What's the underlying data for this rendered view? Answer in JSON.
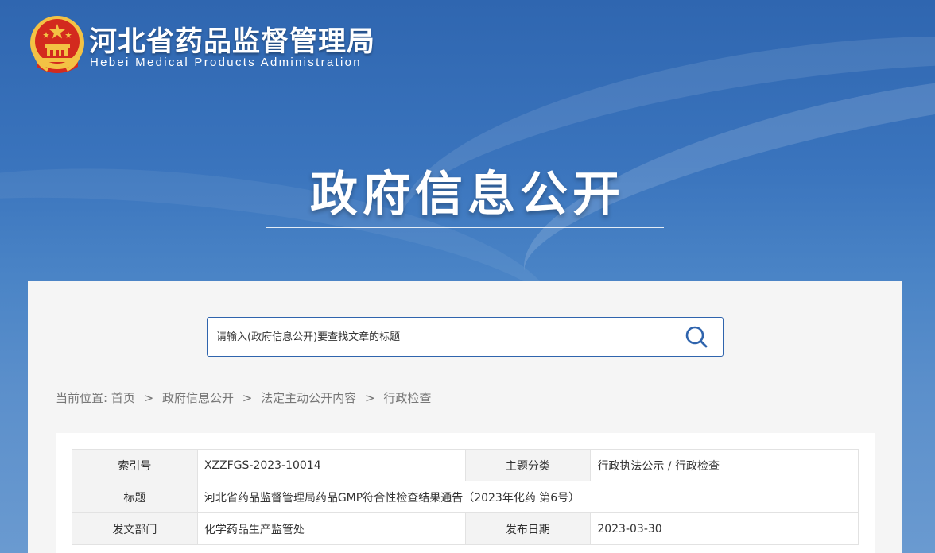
{
  "header": {
    "org_name_cn": "河北省药品监督管理局",
    "org_name_en": "Hebei Medical Products Administration",
    "page_heading": "政府信息公开",
    "colors": {
      "hero_blue": "#3a74bd",
      "emblem_red": "#d32a1e",
      "emblem_gold": "#f3c244"
    }
  },
  "search": {
    "placeholder": "请输入(政府信息公开)要查找文章的标题",
    "icon": "search-icon"
  },
  "breadcrumb": {
    "prefix": "当前位置:",
    "items": [
      "首页",
      "政府信息公开",
      "法定主动公开内容",
      "行政检查"
    ],
    "separator": ">"
  },
  "info_table": {
    "index_label": "索引号",
    "index_value": "XZZFGS-2023-10014",
    "topic_label": "主题分类",
    "topic_value": "行政执法公示 / 行政检查",
    "title_label": "标题",
    "title_value": "河北省药品监督管理局药品GMP符合性检查结果通告（2023年化药 第6号）",
    "dept_label": "发文部门",
    "dept_value": "化学药品生产监管处",
    "date_label": "发布日期",
    "date_value": "2023-03-30"
  }
}
